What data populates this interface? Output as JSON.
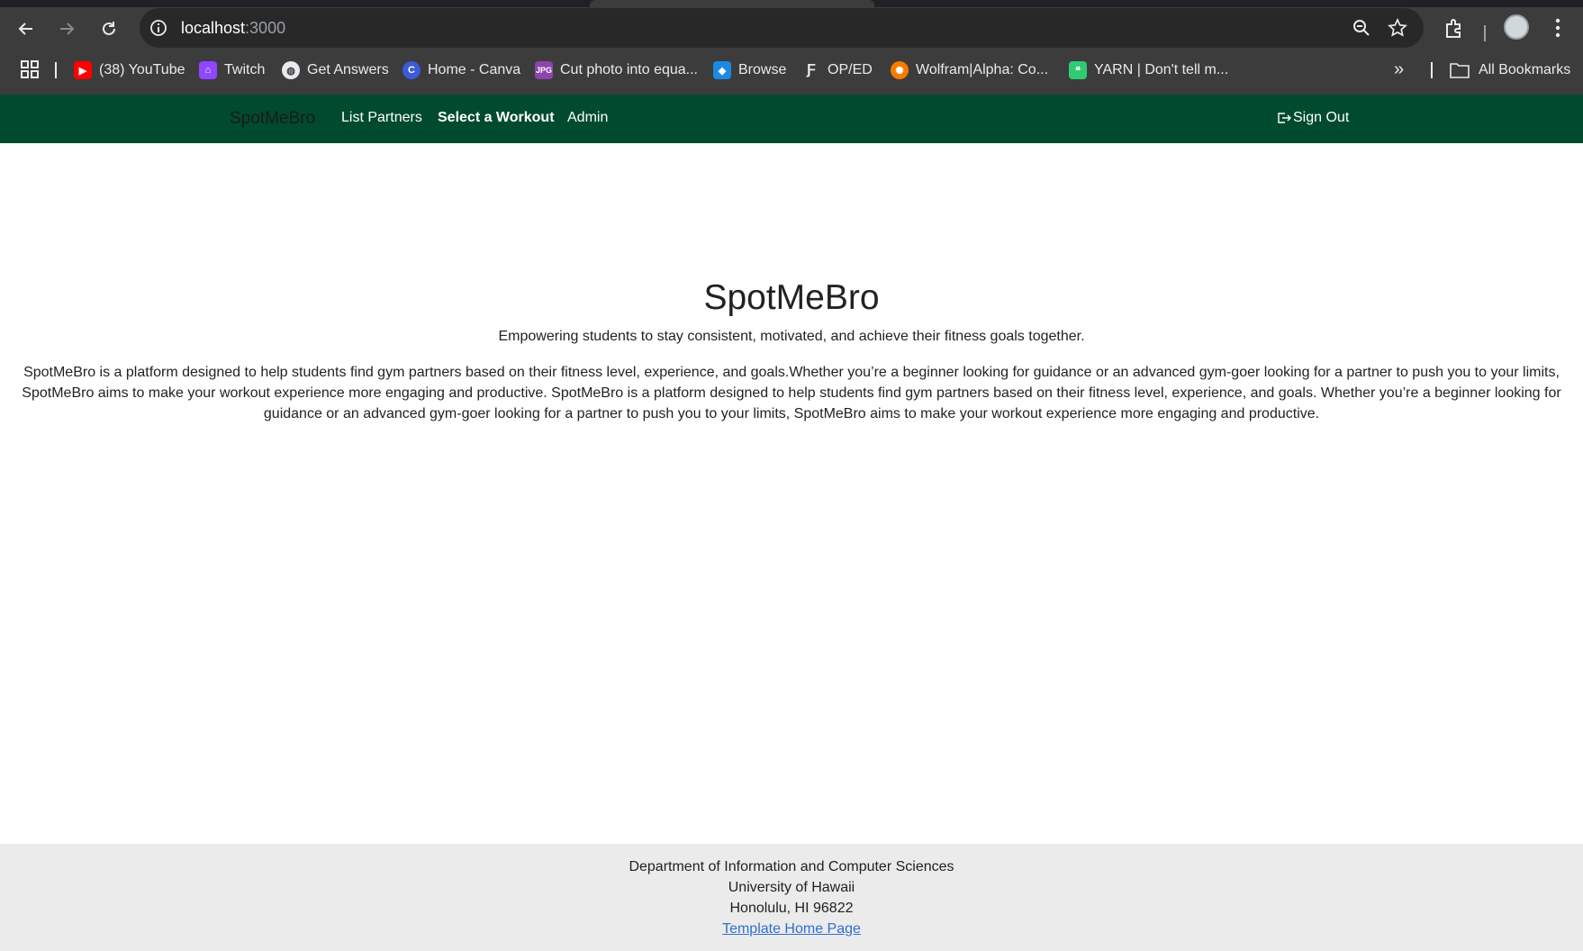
{
  "browser": {
    "url_host": "localhost",
    "url_port": ":3000",
    "bookmarks": [
      {
        "label": "(38) YouTube",
        "icon": "youtube-icon",
        "color": "#ff0000"
      },
      {
        "label": "Twitch",
        "icon": "twitch-icon",
        "color": "#9146ff"
      },
      {
        "label": "Get Answers",
        "icon": "globe-icon",
        "color": "#e8eaed"
      },
      {
        "label": "Home - Canva",
        "icon": "canva-icon",
        "color": "#3b5bdb"
      },
      {
        "label": "Cut photo into equa...",
        "icon": "jpg-icon",
        "color": "#8e44ad"
      },
      {
        "label": "Browse",
        "icon": "browse-icon",
        "color": "#1e88e5"
      },
      {
        "label": "OP/ED",
        "icon": "oped-icon",
        "color": "#e8eaed"
      },
      {
        "label": "Wolfram|Alpha: Co...",
        "icon": "wolfram-icon",
        "color": "#f57c00"
      },
      {
        "label": "YARN | Don't tell m...",
        "icon": "yarn-icon",
        "color": "#2ecc71"
      }
    ],
    "all_bookmarks": "All Bookmarks"
  },
  "navbar": {
    "brand": "SpotMeBro",
    "links": [
      "List Partners",
      "Select a Workout",
      "Admin"
    ],
    "sign_out": "Sign Out",
    "background": "#004b2e"
  },
  "main": {
    "title": "SpotMeBro",
    "subtitle": "Empowering students to stay consistent, motivated, and achieve their fitness goals together.",
    "description": "SpotMeBro is a platform designed to help students find gym partners based on their fitness level, experience, and goals.Whether you’re a beginner looking for guidance or an advanced gym-goer looking for a partner to push you to your limits, SpotMeBro aims to make your workout experience more engaging and productive. SpotMeBro is a platform designed to help students find gym partners based on their fitness level, experience, and goals. Whether you’re a beginner looking for guidance or an advanced gym-goer looking for a partner to push you to your limits, SpotMeBro aims to make your workout experience more engaging and productive."
  },
  "footer": {
    "line1": "Department of Information and Computer Sciences",
    "line2": "University of Hawaii",
    "line3": "Honolulu, HI 96822",
    "link": "Template Home Page"
  }
}
